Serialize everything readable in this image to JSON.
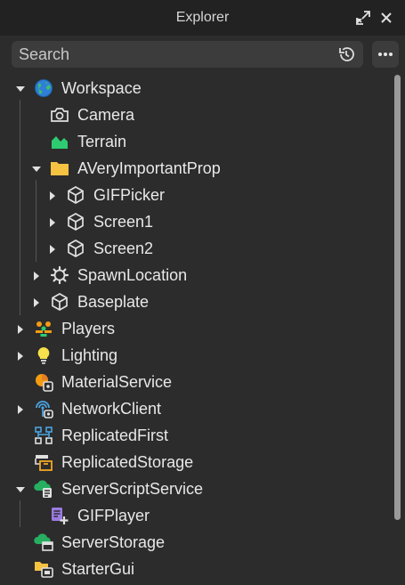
{
  "panel": {
    "title": "Explorer",
    "undock_icon": "undock-icon",
    "close_icon": "close-icon"
  },
  "search": {
    "placeholder": "Search",
    "value": "",
    "history_icon": "history-icon",
    "more_icon": "more-options-icon"
  },
  "tree": [
    {
      "label": "Workspace",
      "icon": "workspace-globe-icon",
      "expanded": true
    },
    {
      "label": "Camera",
      "icon": "camera-icon"
    },
    {
      "label": "Terrain",
      "icon": "terrain-icon"
    },
    {
      "label": "AVeryImportantProp",
      "icon": "folder-icon",
      "expanded": true
    },
    {
      "label": "GIFPicker",
      "icon": "model-icon",
      "expanded": false
    },
    {
      "label": "Screen1",
      "icon": "model-icon",
      "expanded": false
    },
    {
      "label": "Screen2",
      "icon": "model-icon",
      "expanded": false
    },
    {
      "label": "SpawnLocation",
      "icon": "spawn-gear-icon",
      "expanded": false
    },
    {
      "label": "Baseplate",
      "icon": "model-icon",
      "expanded": false
    },
    {
      "label": "Players",
      "icon": "players-icon",
      "expanded": false
    },
    {
      "label": "Lighting",
      "icon": "lightbulb-icon",
      "expanded": false
    },
    {
      "label": "MaterialService",
      "icon": "material-service-icon"
    },
    {
      "label": "NetworkClient",
      "icon": "network-client-icon",
      "expanded": false
    },
    {
      "label": "ReplicatedFirst",
      "icon": "replicated-first-icon"
    },
    {
      "label": "ReplicatedStorage",
      "icon": "replicated-storage-icon"
    },
    {
      "label": "ServerScriptService",
      "icon": "server-script-service-icon",
      "expanded": true
    },
    {
      "label": "GIFPlayer",
      "icon": "script-icon"
    },
    {
      "label": "ServerStorage",
      "icon": "server-storage-icon"
    },
    {
      "label": "StarterGui",
      "icon": "starter-gui-icon"
    }
  ],
  "colors": {
    "background": "#2c2c2c",
    "titlebar": "#222222",
    "input": "#3c3c3c",
    "text": "#e8e8e8",
    "terrain_green": "#2ecc71",
    "folder_yellow": "#f5c242",
    "players_orange": "#f39c12",
    "lighting_yellow": "#f7e04b",
    "service_blue": "#4aa3df",
    "server_green": "#27ae60",
    "script_purple": "#9b7be0"
  }
}
